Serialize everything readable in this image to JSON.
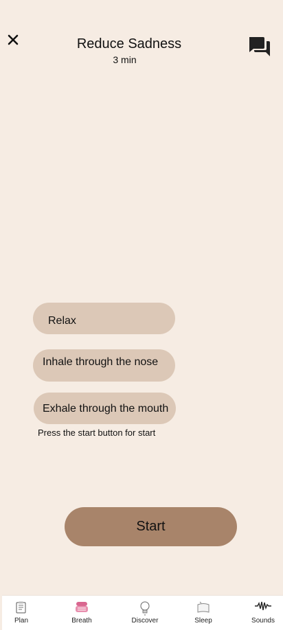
{
  "header": {
    "title": "Reduce Sadness",
    "duration": "3 min",
    "close_icon": "close-icon",
    "chat_icon": "chat-bubbles-icon"
  },
  "instructions": [
    {
      "label": "Relax"
    },
    {
      "label": "Inhale through the nose"
    },
    {
      "label": "Exhale through the mouth"
    }
  ],
  "hint": "Press the start button for start",
  "start_button": {
    "label": "Start"
  },
  "bottom_nav": [
    {
      "label": "Plan",
      "icon": "notepad-icon"
    },
    {
      "label": "Breath",
      "icon": "lungs-icon"
    },
    {
      "label": "Discover",
      "icon": "lightbulb-icon"
    },
    {
      "label": "Sleep",
      "icon": "pillow-icon"
    },
    {
      "label": "Sounds",
      "icon": "soundwave-icon"
    }
  ],
  "colors": {
    "background": "#f6ece3",
    "pill": "#dcc8b7",
    "start_button": "#a8846a",
    "accent_pink": "#d9668f"
  }
}
